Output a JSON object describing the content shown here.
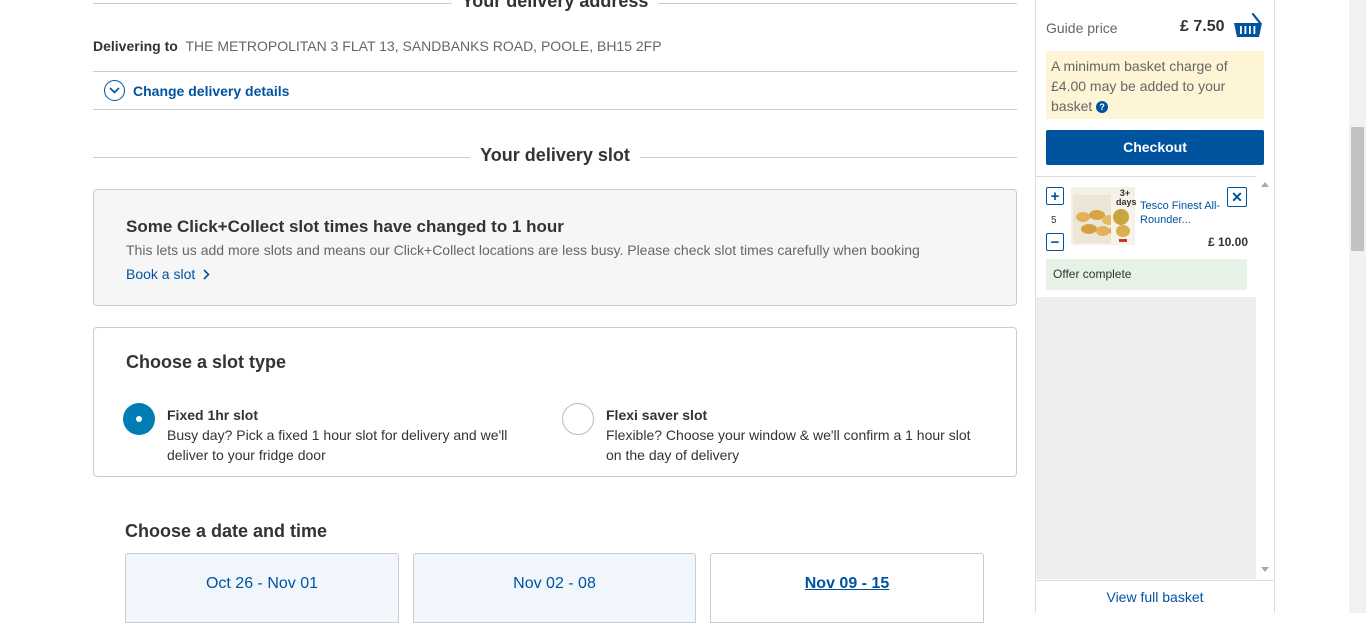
{
  "delivery_address": {
    "heading": "Your delivery address",
    "label": "Delivering to",
    "address": "THE METROPOLITAN 3 FLAT 13, SANDBANKS ROAD, POOLE, BH15 2FP",
    "change_link": "Change delivery details"
  },
  "delivery_slot": {
    "heading": "Your delivery slot",
    "notice": {
      "title": "Some Click+Collect slot times have changed to 1 hour",
      "text": "This lets us add more slots and means our Click+Collect locations are less busy. Please check slot times carefully when booking",
      "link": "Book a slot"
    },
    "slot_type": {
      "title": "Choose a slot type",
      "options": [
        {
          "title": "Fixed 1hr slot",
          "desc": "Busy day? Pick a fixed 1 hour slot for delivery and we'll deliver to your fridge door",
          "selected": true
        },
        {
          "title": "Flexi saver slot",
          "desc": "Flexible? Choose your window & we'll confirm a 1 hour slot on the day of delivery",
          "selected": false
        }
      ]
    },
    "date_title": "Choose a date and time",
    "weeks": [
      {
        "label": "Oct 26 - Nov 01",
        "active": false
      },
      {
        "label": "Nov 02 - 08",
        "active": false
      },
      {
        "label": "Nov 09 - 15",
        "active": true
      }
    ]
  },
  "basket": {
    "guide_label": "Guide price",
    "guide_price": "£ 7.50",
    "min_charge_notice": "A minimum basket charge of £4.00 may be added to your basket",
    "help_glyph": "?",
    "checkout_label": "Checkout",
    "items": [
      {
        "qty": "5",
        "name": "Tesco Finest All-Rounder...",
        "price": "£ 10.00",
        "badge": "3+ days",
        "offer": "Offer complete"
      }
    ],
    "view_full_label": "View full basket"
  },
  "colors": {
    "brand_blue": "#00539f",
    "radio_blue": "#007eb3",
    "notice_yellow": "#fdf5d5",
    "offer_green": "#e6f2e5"
  }
}
